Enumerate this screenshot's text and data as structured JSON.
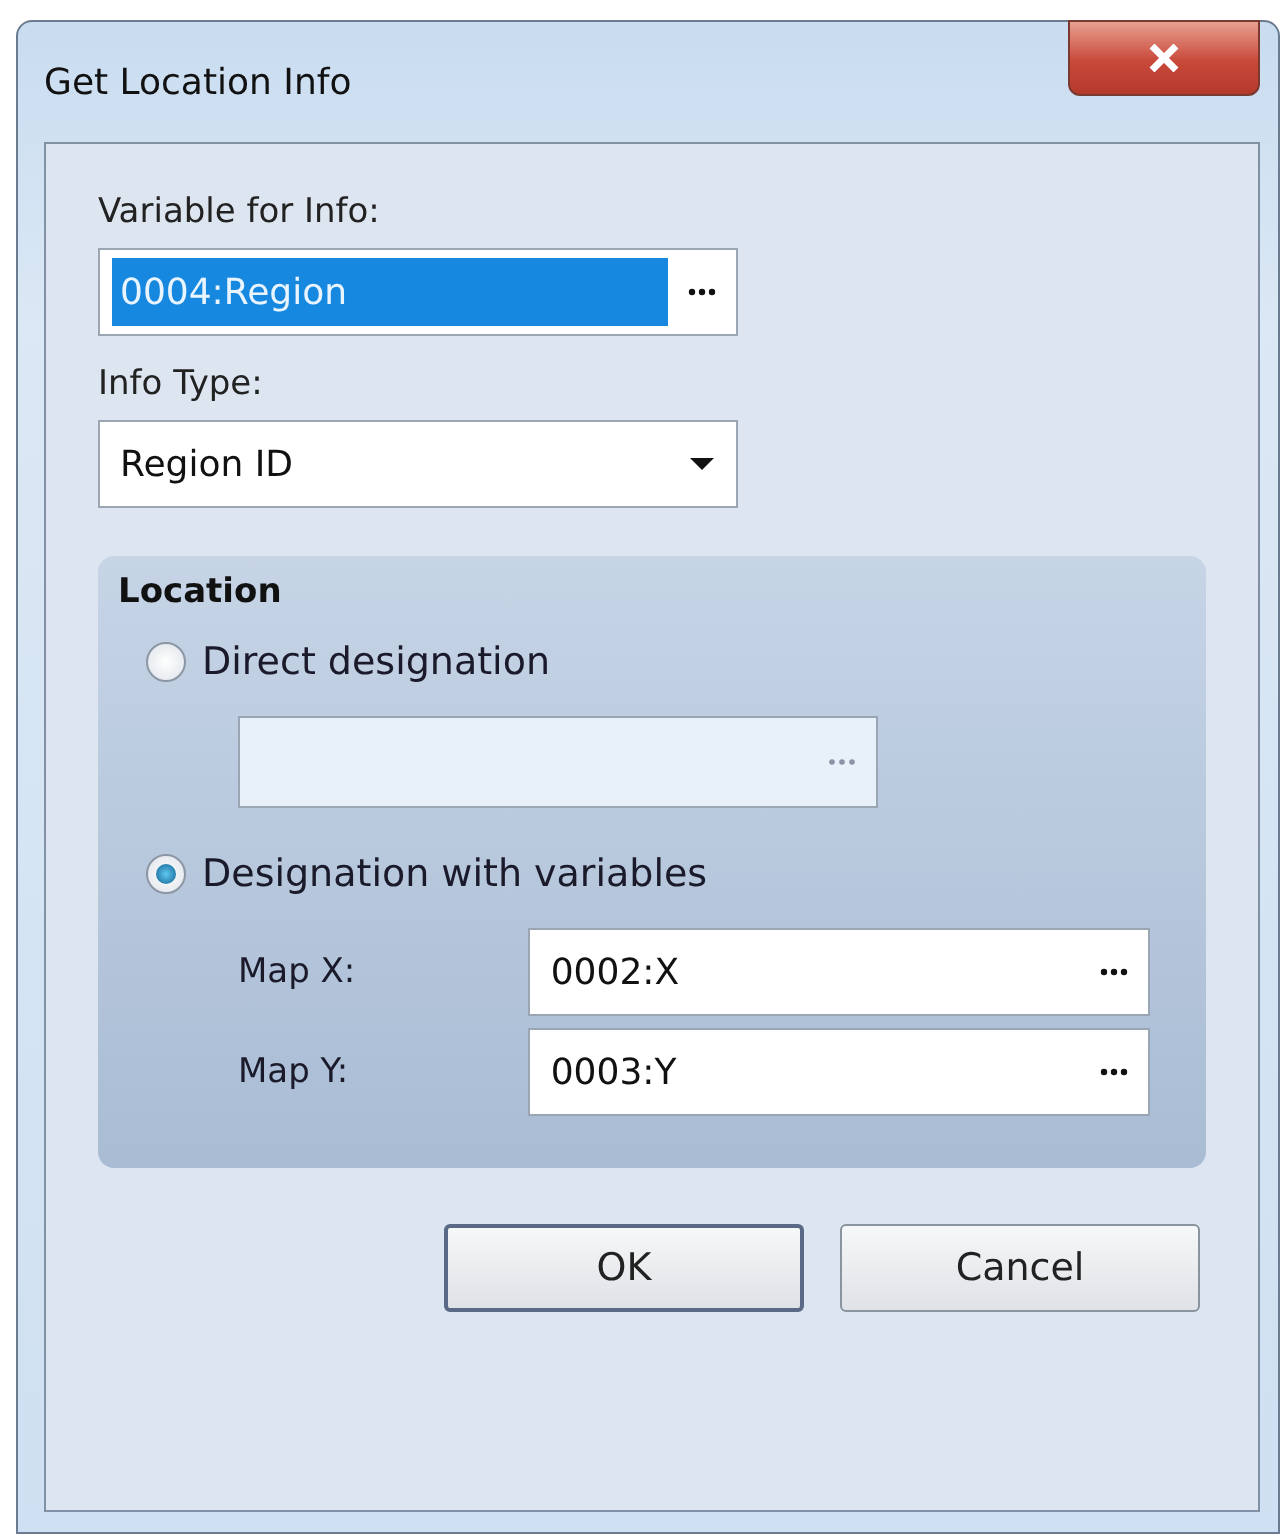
{
  "window": {
    "title": "Get Location Info"
  },
  "variable_for_info": {
    "label": "Variable for Info:",
    "value": "0004:Region",
    "selected": true
  },
  "info_type": {
    "label": "Info Type:",
    "value": "Region ID"
  },
  "location": {
    "title": "Location",
    "options": [
      {
        "label": "Direct designation",
        "selected": false,
        "field": {
          "disabled": true
        }
      },
      {
        "label": "Designation with variables",
        "selected": true,
        "fields": [
          {
            "label": "Map X:",
            "value": "0002:X"
          },
          {
            "label": "Map Y:",
            "value": "0003:Y"
          }
        ]
      }
    ]
  },
  "buttons": [
    {
      "label": "OK",
      "default": true
    },
    {
      "label": "Cancel",
      "default": false
    }
  ]
}
